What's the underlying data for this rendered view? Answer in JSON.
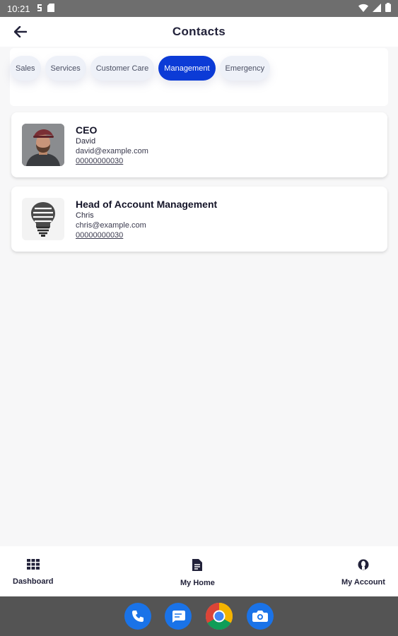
{
  "status_bar": {
    "time": "10:21"
  },
  "app_bar": {
    "title": "Contacts"
  },
  "tabs": [
    {
      "label": "Sales",
      "active": false
    },
    {
      "label": "Services",
      "active": false
    },
    {
      "label": "Customer Care",
      "active": false
    },
    {
      "label": "Management",
      "active": true
    },
    {
      "label": "Emergency",
      "active": false
    }
  ],
  "contacts": [
    {
      "role": "CEO",
      "name": "David",
      "email": "david@example.com",
      "phone": "00000000030",
      "avatar": "portrait-photo"
    },
    {
      "role": "Head of Account Management",
      "name": "Chris",
      "email": "chris@example.com",
      "phone": "00000000030",
      "avatar": "sales-team-bulb-image"
    }
  ],
  "bottom_nav": [
    {
      "label": "Dashboard",
      "icon": "grid-icon"
    },
    {
      "label": "My Home",
      "icon": "document-icon"
    },
    {
      "label": "My Account",
      "icon": "person-icon"
    }
  ],
  "dock_apps": [
    "phone-app",
    "messages-app",
    "chrome-app",
    "camera-app"
  ],
  "colors": {
    "accent": "#0c3bd6",
    "chip_bg": "#eef1f8",
    "background": "#f7f7f8"
  }
}
